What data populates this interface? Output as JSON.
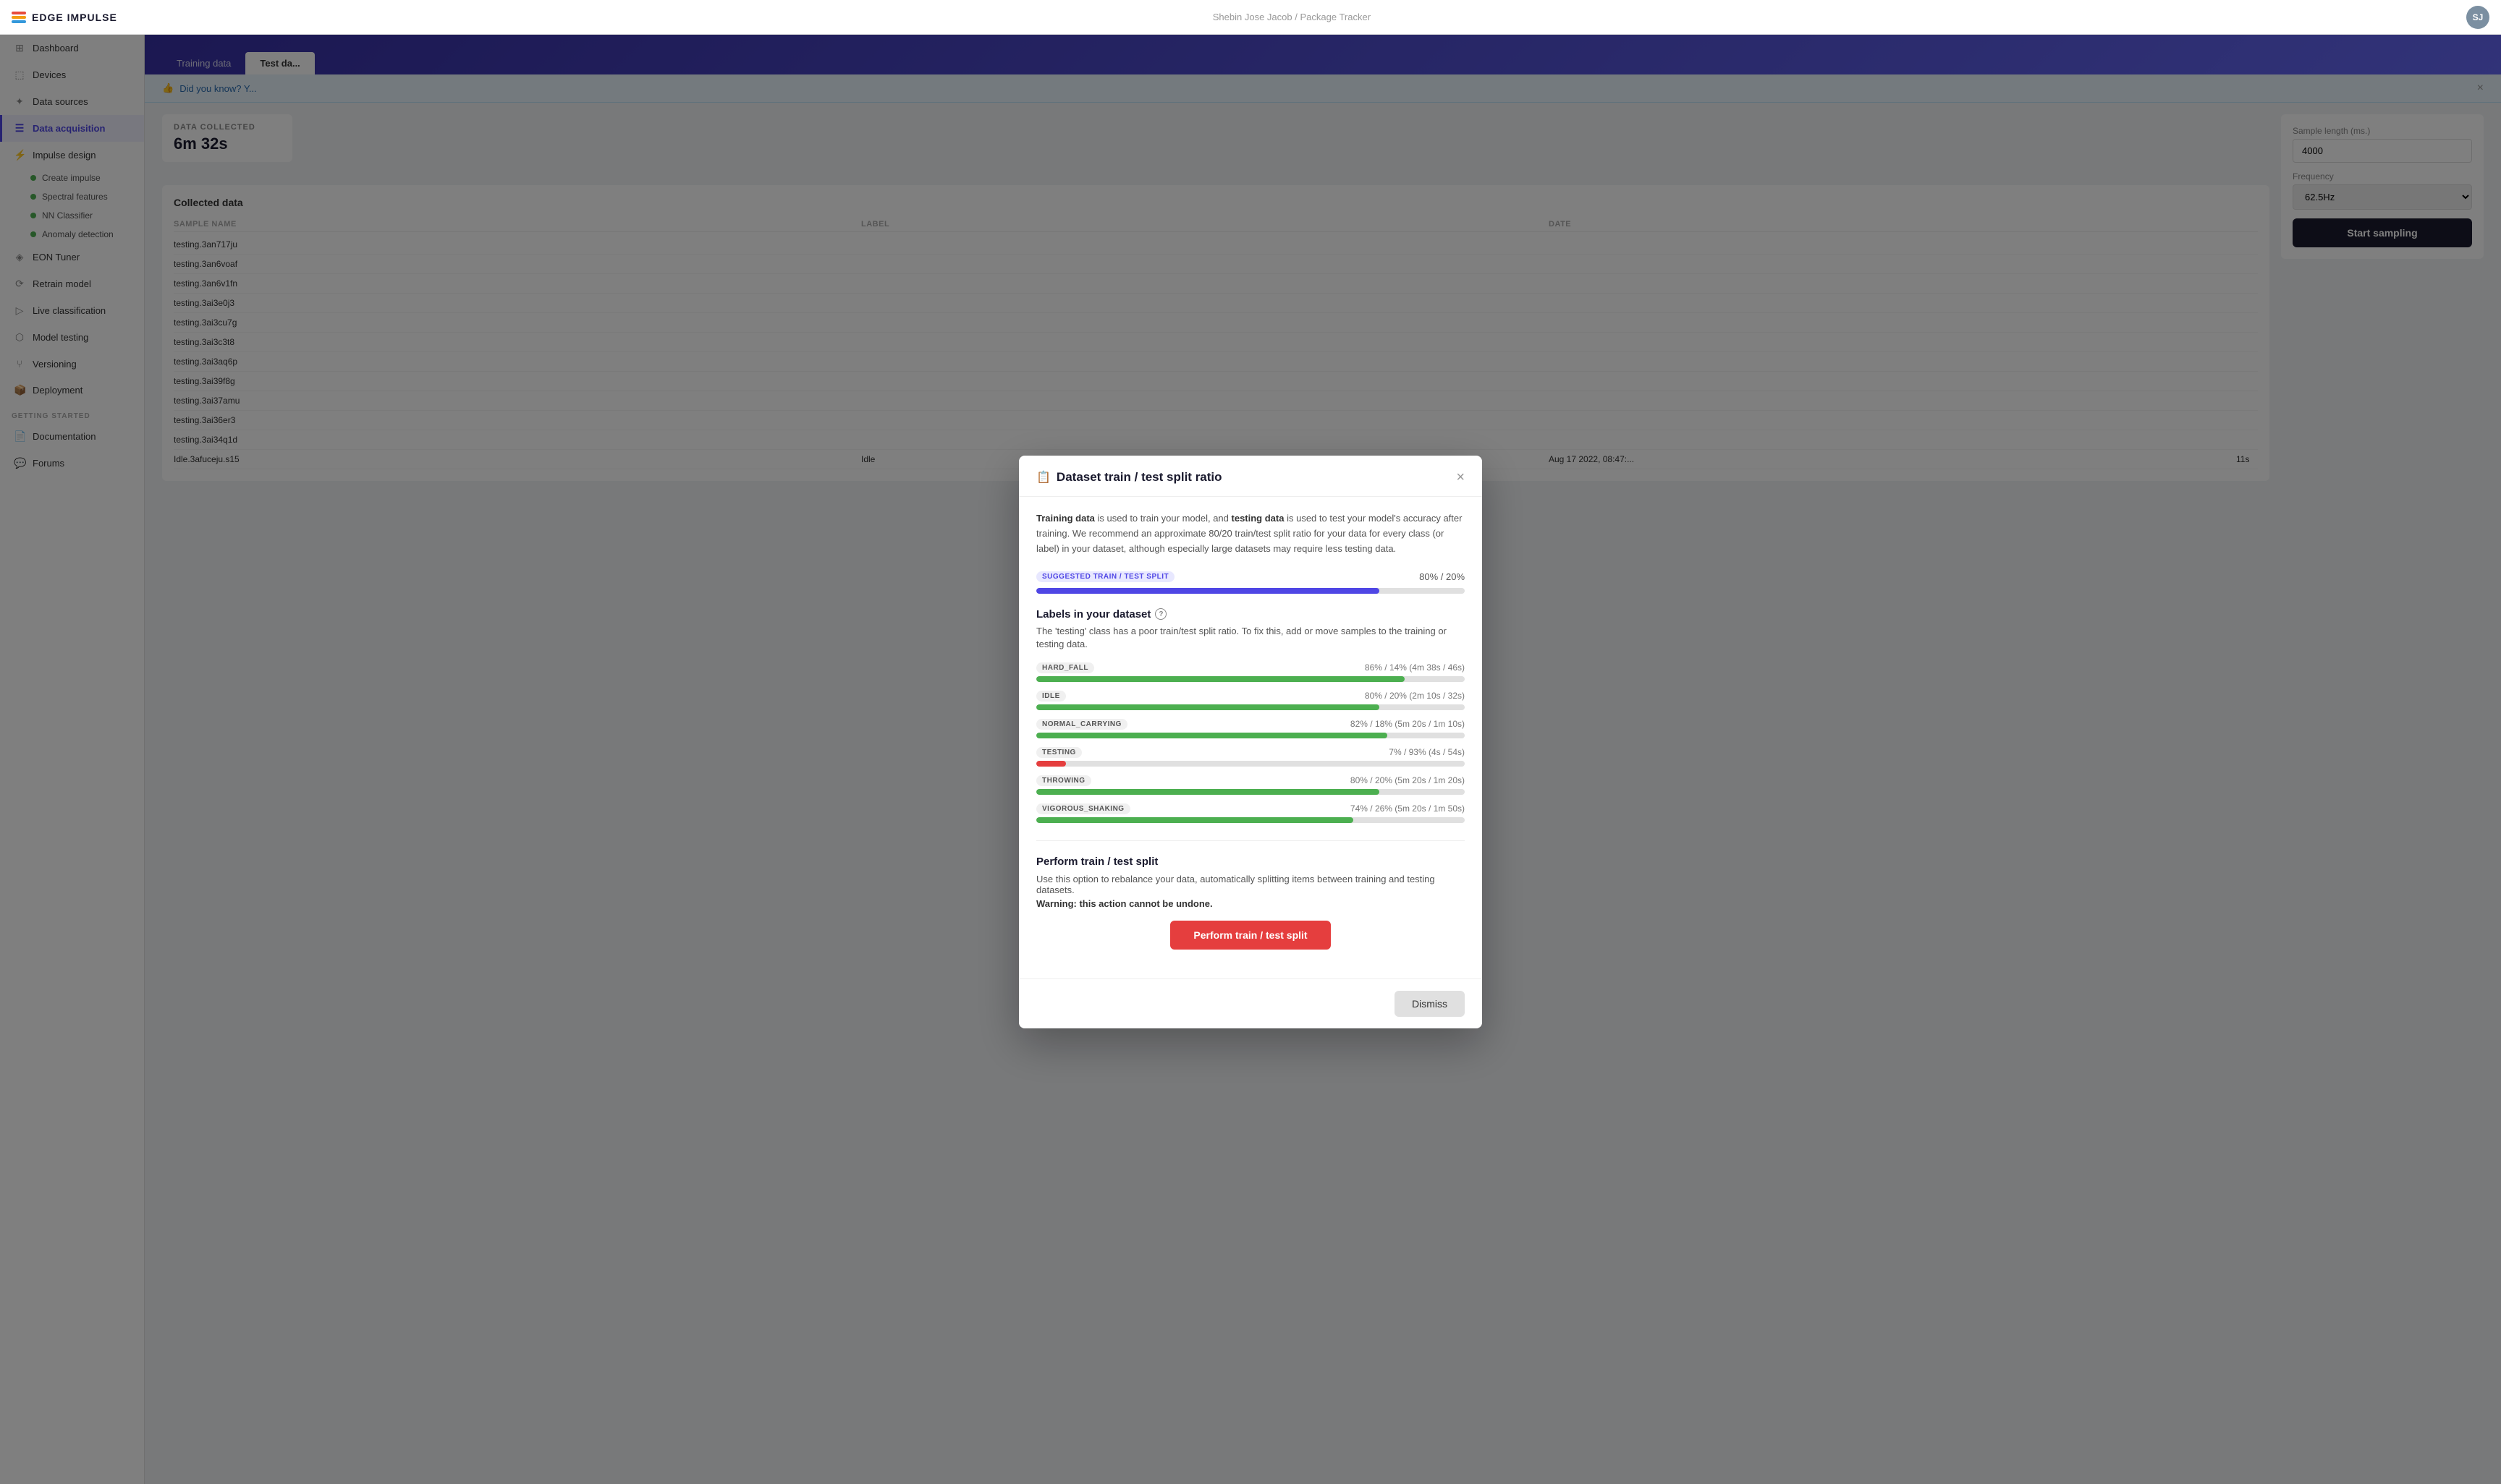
{
  "header": {
    "logo_text": "EDGE IMPULSE",
    "user_name": "Shebin Jose Jacob",
    "project_name": "Package Tracker",
    "separator": "/"
  },
  "sidebar": {
    "items": [
      {
        "id": "dashboard",
        "label": "Dashboard",
        "icon": "⊞"
      },
      {
        "id": "devices",
        "label": "Devices",
        "icon": "⬚"
      },
      {
        "id": "data-sources",
        "label": "Data sources",
        "icon": "✦"
      },
      {
        "id": "data-acquisition",
        "label": "Data acquisition",
        "icon": "☰",
        "active": true
      },
      {
        "id": "impulse-design",
        "label": "Impulse design",
        "icon": "⚡"
      }
    ],
    "sub_items": [
      {
        "id": "create-impulse",
        "label": "Create impulse"
      },
      {
        "id": "spectral-features",
        "label": "Spectral features"
      },
      {
        "id": "nn-classifier",
        "label": "NN Classifier"
      },
      {
        "id": "anomaly-detection",
        "label": "Anomaly detection"
      }
    ],
    "more_items": [
      {
        "id": "eon-tuner",
        "label": "EON Tuner",
        "icon": "◈"
      },
      {
        "id": "retrain-model",
        "label": "Retrain model",
        "icon": "⟳"
      },
      {
        "id": "live-classification",
        "label": "Live classification",
        "icon": "▷"
      },
      {
        "id": "model-testing",
        "label": "Model testing",
        "icon": "⬡"
      },
      {
        "id": "versioning",
        "label": "Versioning",
        "icon": "⑂"
      },
      {
        "id": "deployment",
        "label": "Deployment",
        "icon": "📦"
      }
    ],
    "section_label": "GETTING STARTED",
    "getting_started": [
      {
        "id": "documentation",
        "label": "Documentation",
        "icon": "📄"
      },
      {
        "id": "forums",
        "label": "Forums",
        "icon": "💬"
      }
    ]
  },
  "page": {
    "tabs": [
      {
        "id": "training-data",
        "label": "Training data",
        "active": false
      },
      {
        "id": "test-data",
        "label": "Test da...",
        "active": true
      }
    ],
    "info_banner": "Did you know? Y...",
    "data_collected_label": "DATA COLLECTED",
    "data_collected_value": "6m 32s"
  },
  "collected_data": {
    "title": "Collected data",
    "columns": [
      "SAMPLE NAME",
      "",
      "",
      ""
    ],
    "rows": [
      {
        "name": "testing.3an717ju"
      },
      {
        "name": "testing.3an6voaf"
      },
      {
        "name": "testing.3an6v1fn"
      },
      {
        "name": "testing.3ai3e0j3"
      },
      {
        "name": "testing.3ai3cu7g"
      },
      {
        "name": "testing.3ai3c3t8"
      },
      {
        "name": "testing.3ai3aq6p"
      },
      {
        "name": "testing.3ai39f8g"
      },
      {
        "name": "testing.3ai37amu"
      },
      {
        "name": "testing.3ai36er3"
      },
      {
        "name": "testing.3ai34q1d"
      },
      {
        "name": "Idle.3afuceju.s15",
        "label": "Idle",
        "date": "Aug 17 2022, 08:47:...",
        "duration": "11s"
      }
    ]
  },
  "modal": {
    "title": "Dataset train / test split ratio",
    "close_label": "×",
    "description_1": "Training data",
    "description_2": " is used to train your model, and ",
    "description_3": "testing data",
    "description_4": " is used to test your model's accuracy after training. We recommend an approximate 80/20 train/test split ratio for your data for every class (or label) in your dataset, although especially large datasets may require less testing data.",
    "suggested_badge": "SUGGESTED TRAIN / TEST SPLIT",
    "suggested_percent": "80% / 20%",
    "suggested_fill_pct": 80,
    "labels_title": "Labels in your dataset",
    "labels_subtitle": "The 'testing' class has a poor train/test split ratio. To fix this, add or move samples to the training or testing data.",
    "labels": [
      {
        "name": "HARD_FALL",
        "stats": "86% / 14% (4m 38s / 46s)",
        "fill_pct": 86,
        "color": "green"
      },
      {
        "name": "IDLE",
        "stats": "80% / 20% (2m 10s / 32s)",
        "fill_pct": 80,
        "color": "green"
      },
      {
        "name": "NORMAL_CARRYING",
        "stats": "82% / 18% (5m 20s / 1m 10s)",
        "fill_pct": 82,
        "color": "green"
      },
      {
        "name": "TESTING",
        "stats": "7% / 93% (4s / 54s)",
        "fill_pct": 7,
        "color": "red"
      },
      {
        "name": "THROWING",
        "stats": "80% / 20% (5m 20s / 1m 20s)",
        "fill_pct": 80,
        "color": "green"
      },
      {
        "name": "VIGOROUS_SHAKING",
        "stats": "74% / 26% (5m 20s / 1m 50s)",
        "fill_pct": 74,
        "color": "green"
      }
    ],
    "perform_title": "Perform train / test split",
    "perform_description": "Use this option to rebalance your data, automatically splitting items between training and testing datasets.",
    "perform_warning": "Warning: this action cannot be undone.",
    "perform_button_label": "Perform train / test split",
    "dismiss_label": "Dismiss"
  },
  "right_panel": {
    "sample_length_label": "Sample length (ms.)",
    "sample_length_value": "4000",
    "frequency_label": "Frequency",
    "frequency_value": "62.5Hz",
    "start_button_label": "Start sampling"
  }
}
